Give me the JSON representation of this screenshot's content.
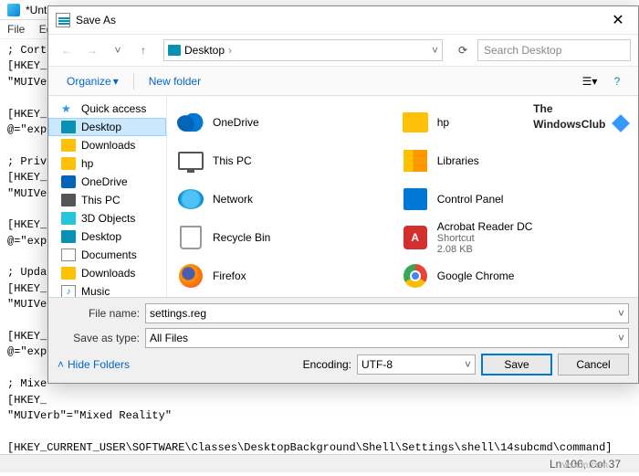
{
  "notepad": {
    "title_prefix": "*Unt",
    "menu": {
      "file": "File",
      "edit": "Ed"
    },
    "body": "; Cort\n[HKEY_\n\"MUIVe\n\n[HKEY_\n@=\"exp\n\n; Priv\n[HKEY_\n\"MUIVe\n\n[HKEY_\n@=\"exp\n\n; Upda\n[HKEY_\n\"MUIVe\n\n[HKEY_\n@=\"exp\n\n; Mixe\n[HKEY_\n\"MUIVerb\"=\"Mixed Reality\"\n\n[HKEY_CURRENT_USER\\SOFTWARE\\Classes\\DesktopBackground\\Shell\\Settings\\shell\\14subcmd\\command]\n@=\"explorer ms-settings:holographic\"",
    "status": "Ln 106, Col 37",
    "watermark": "wsxdn.com"
  },
  "dialog": {
    "title": "Save As",
    "addr_location": "Desktop",
    "search_placeholder": "Search Desktop",
    "toolbar": {
      "organize": "Organize",
      "newfolder": "New folder"
    },
    "tree": [
      {
        "label": "Quick access",
        "icon": "star"
      },
      {
        "label": "Desktop",
        "icon": "desk",
        "sel": true
      },
      {
        "label": "Downloads",
        "icon": "dl"
      },
      {
        "label": "hp",
        "icon": "hp"
      },
      {
        "label": "OneDrive",
        "icon": "od"
      },
      {
        "label": "This PC",
        "icon": "pc"
      },
      {
        "label": "3D Objects",
        "icon": "3d"
      },
      {
        "label": "Desktop",
        "icon": "desk"
      },
      {
        "label": "Documents",
        "icon": "doc"
      },
      {
        "label": "Downloads",
        "icon": "dl"
      },
      {
        "label": "Music",
        "icon": "mus"
      }
    ],
    "left_items": [
      {
        "name": "OneDrive",
        "ic": "onedrive"
      },
      {
        "name": "This PC",
        "ic": "thispc"
      },
      {
        "name": "Network",
        "ic": "net"
      },
      {
        "name": "Recycle Bin",
        "ic": "bin"
      },
      {
        "name": "Firefox",
        "ic": "ff"
      }
    ],
    "right_items": [
      {
        "name": "hp",
        "ic": "folder"
      },
      {
        "name": "Libraries",
        "ic": "lib"
      },
      {
        "name": "Control Panel",
        "ic": "cp"
      },
      {
        "name": "Acrobat Reader DC",
        "ic": "adobe",
        "sub1": "Shortcut",
        "sub2": "2.08 KB"
      },
      {
        "name": "Google Chrome",
        "ic": "chrome"
      }
    ],
    "brand1": "The",
    "brand2": "WindowsClub",
    "filename_label": "File name:",
    "filename_value": "settings.reg",
    "saveastype_label": "Save as type:",
    "saveastype_value": "All Files",
    "hide_folders": "Hide Folders",
    "encoding_label": "Encoding:",
    "encoding_value": "UTF-8",
    "save": "Save",
    "cancel": "Cancel"
  }
}
